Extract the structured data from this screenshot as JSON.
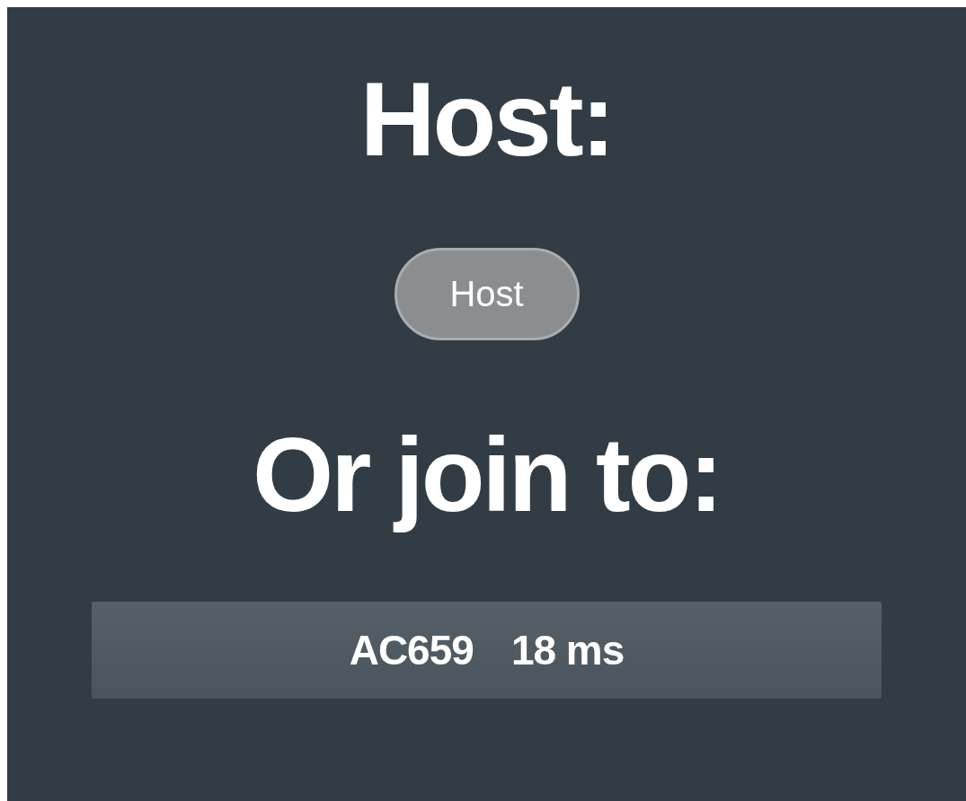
{
  "host_heading": "Host:",
  "host_button": {
    "label": "Host"
  },
  "join_heading": "Or join to:",
  "servers": [
    {
      "name": "AC659",
      "ping": "18 ms"
    }
  ]
}
